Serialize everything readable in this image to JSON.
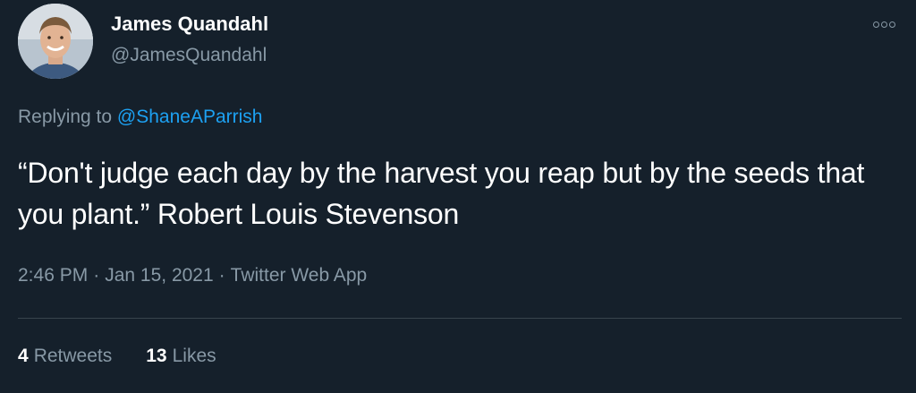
{
  "user": {
    "display_name": "James Quandahl",
    "handle": "@JamesQuandahl"
  },
  "reply": {
    "prefix": "Replying to ",
    "mention": "@ShaneAParrish"
  },
  "tweet": {
    "text": "“Don't judge each day by the harvest you reap but by the seeds that you plant.” Robert Louis Stevenson"
  },
  "meta": {
    "time": "2:46 PM",
    "date": "Jan 15, 2021",
    "source": "Twitter Web App",
    "separator": "·"
  },
  "stats": {
    "retweets_count": "4",
    "retweets_label": "Retweets",
    "likes_count": "13",
    "likes_label": "Likes"
  },
  "colors": {
    "background": "#15202b",
    "text": "#ffffff",
    "secondary": "#8899a6",
    "link": "#1da1f2",
    "divider": "#38444d"
  },
  "icons": {
    "more": "more-icon"
  }
}
